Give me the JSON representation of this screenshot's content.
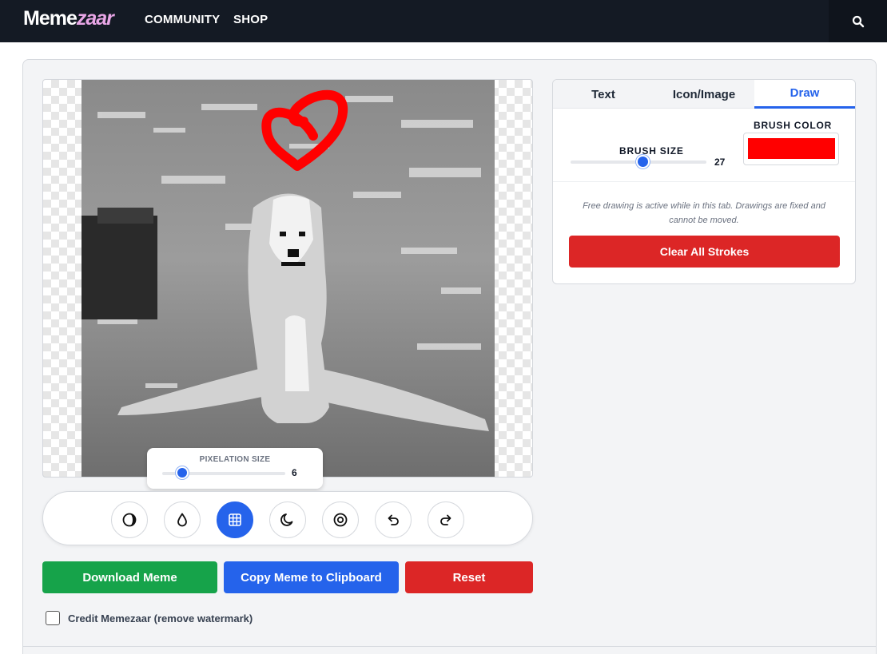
{
  "header": {
    "logo_part1": "Meme",
    "logo_part2": "zaar",
    "nav": [
      "COMMUNITY",
      "SHOP"
    ]
  },
  "editor": {
    "pixelation": {
      "label": "PIXELATION SIZE",
      "value": "6",
      "fraction": 0.16
    },
    "tools": [
      {
        "icon": "contrast-icon",
        "active": false
      },
      {
        "icon": "drop-icon",
        "active": false
      },
      {
        "icon": "grid-icon",
        "active": true
      },
      {
        "icon": "moon-icon",
        "active": false
      },
      {
        "icon": "target-icon",
        "active": false
      },
      {
        "icon": "undo-icon",
        "active": false
      },
      {
        "icon": "redo-icon",
        "active": false
      }
    ],
    "buttons": {
      "download": "Download Meme",
      "copy": "Copy Meme to Clipboard",
      "reset": "Reset"
    },
    "credit_label": "Credit Memezaar (remove watermark)"
  },
  "panel": {
    "tabs": [
      {
        "label": "Text",
        "active": false
      },
      {
        "label": "Icon/Image",
        "active": false
      },
      {
        "label": "Draw",
        "active": true
      }
    ],
    "brush_size_label": "BRUSH SIZE",
    "brush_size_value": "27",
    "brush_size_fraction": 0.53,
    "brush_color_label": "BRUSH COLOR",
    "brush_color": "#ff0000",
    "note": "Free drawing is active while in this tab. Drawings are fixed and cannot be moved.",
    "clear_button": "Clear All Strokes"
  },
  "colors": {
    "header_bg": "#141a24",
    "accent": "#2563eb",
    "success": "#16a34a",
    "danger": "#dc2626"
  }
}
